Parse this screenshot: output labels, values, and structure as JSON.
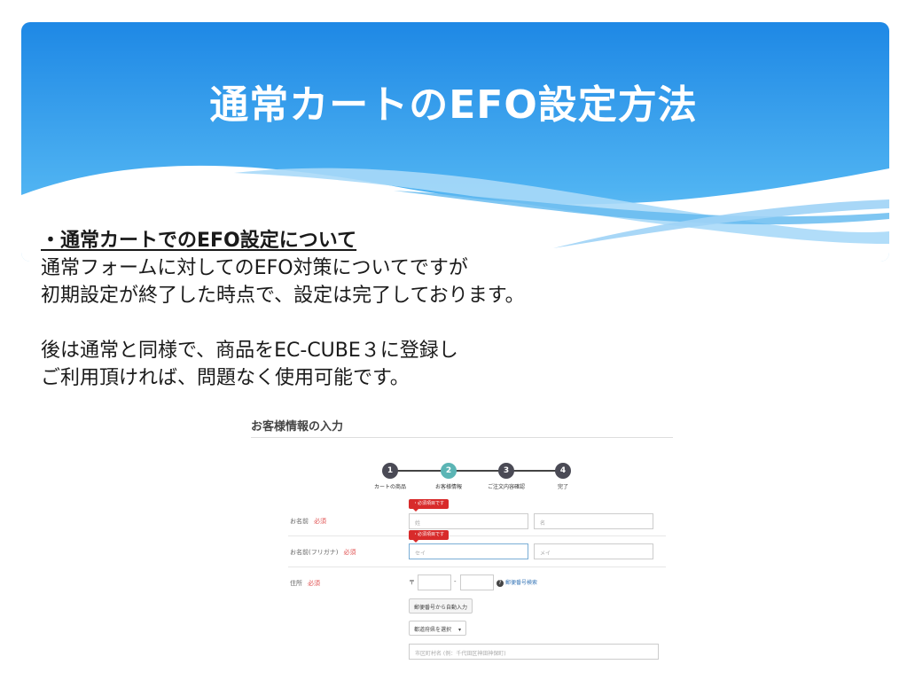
{
  "slide": {
    "title": "通常カートのEFO設定方法",
    "heading": "・通常カートでのEFO設定について",
    "lines": [
      "通常フォームに対してのEFO対策についてですが",
      "初期設定が終了した時点で、設定は完了しております。",
      "後は通常と同様で、商品をEC-CUBE３に登録し",
      "ご利用頂ければ、問題なく使用可能です。"
    ],
    "colors": {
      "banner_top": "#1e88e5",
      "banner_bottom": "#7cc7f5",
      "text": "#1a1a1a"
    }
  },
  "form": {
    "title": "お客様情報の入力",
    "steps": [
      {
        "num": "1",
        "label": "カートの商品"
      },
      {
        "num": "2",
        "label": "お客様情報"
      },
      {
        "num": "3",
        "label": "ご注文内容確認"
      },
      {
        "num": "4",
        "label": "完了"
      }
    ],
    "required_label": "必須",
    "error_tag": "・必須項目です",
    "name_label": "お名前",
    "name_last_placeholder": "姓",
    "name_first_placeholder": "名",
    "kana_label": "お名前(フリガナ)",
    "kana_last_placeholder": "セイ",
    "kana_first_placeholder": "メイ",
    "address_label": "住所",
    "postal_mark": "〒",
    "postal_dash": "-",
    "postal_help_icon": "?",
    "postal_search_link": "郵便番号検索",
    "auto_fill_button": "郵便番号から自動入力",
    "prefecture_select": "都道府県を選択",
    "city_placeholder": "市区町村名 (例：千代田区神田神保町)"
  }
}
